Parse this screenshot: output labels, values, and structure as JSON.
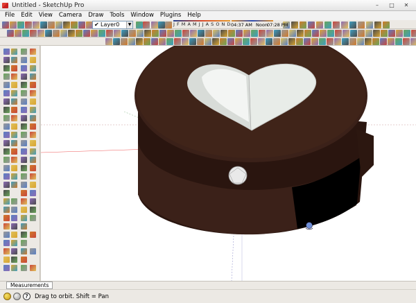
{
  "window": {
    "title": "Untitled - SketchUp Pro",
    "minimize": "–",
    "maximize": "□",
    "close": "✕"
  },
  "menu": [
    "File",
    "Edit",
    "View",
    "Camera",
    "Draw",
    "Tools",
    "Window",
    "Plugins",
    "Help"
  ],
  "layers": {
    "current": "Layer0",
    "check": "✔",
    "arrow": "▼"
  },
  "shadows": {
    "months": "J F M A M J J A S O N D",
    "time_start": "04:37 AM",
    "noon": "Noon",
    "time_end": "07:28 PM"
  },
  "measurements": {
    "tab_label": "Measurements"
  },
  "status": {
    "help_glyph": "?",
    "text": "Drag to orbit.  Shift = Pan"
  },
  "colors": {
    "chrome": "#ece9e4",
    "viewport": "#ffffff",
    "model_brown": "#3a2119",
    "heart": "#e6ebe6"
  },
  "icons": {
    "toolbar_row1": [
      "new-icon",
      "open-icon",
      "save-icon",
      "cut-icon",
      "copy-icon",
      "paste-icon",
      "erase-icon",
      "undo-icon",
      "redo-icon",
      "print-icon",
      "model-info-icon"
    ],
    "left_tools": [
      "select-icon",
      "component-icon",
      "paint-icon",
      "eraser-icon",
      "rectangle-icon",
      "line-icon",
      "circle-icon",
      "arc-icon",
      "polygon-icon",
      "freehand-icon",
      "move-icon",
      "push-pull-icon",
      "rotate-icon",
      "follow-me-icon",
      "scale-icon",
      "offset-icon",
      "tape-icon",
      "dimension-icon",
      "protractor-icon",
      "text-icon",
      "axes-icon",
      "3d-text-icon",
      "orbit-icon",
      "pan-icon",
      "zoom-icon",
      "zoom-window-icon",
      "zoom-extents-icon",
      "previous-icon",
      "position-camera-icon",
      "walk-icon",
      "look-around-icon",
      "section-plane-icon"
    ]
  }
}
